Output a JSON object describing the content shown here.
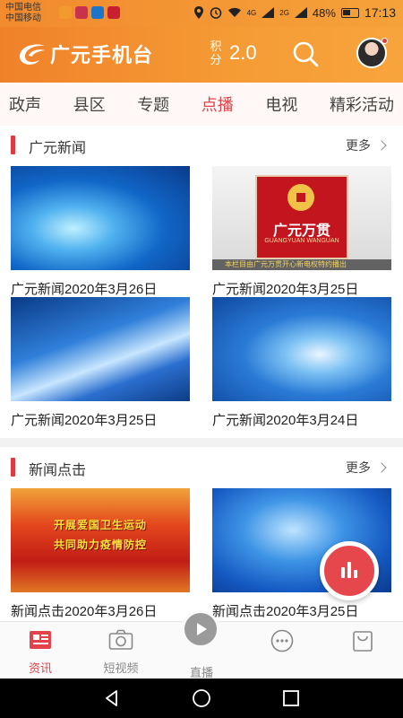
{
  "status_bar": {
    "carrier_1": "中国电信",
    "carrier_2": "中国移动",
    "network_1": "4G",
    "network_2": "2G",
    "battery": "48%",
    "time": "17:13"
  },
  "header": {
    "app_title": "广元手机台",
    "points_label_1": "积",
    "points_label_2": "分",
    "points_value": "2.0",
    "search_icon": "search-icon",
    "avatar_icon": "avatar"
  },
  "tabs": [
    {
      "label": "政声",
      "active": false
    },
    {
      "label": "县区",
      "active": false
    },
    {
      "label": "专题",
      "active": false
    },
    {
      "label": "点播",
      "active": true
    },
    {
      "label": "电视",
      "active": false
    },
    {
      "label": "精彩活动",
      "active": false
    }
  ],
  "sections": [
    {
      "title": "广元新闻",
      "more": "更多",
      "items": [
        {
          "caption": "广元新闻2020年3月26日"
        },
        {
          "caption": "广元新闻2020年3月25日",
          "brand": "广元万贯",
          "brand_sub": "GUANGYUAN WANGUAN",
          "ticker": "本栏目由广元万贯开心新电权特约播出"
        },
        {
          "caption": "广元新闻2020年3月25日"
        },
        {
          "caption": "广元新闻2020年3月24日"
        }
      ]
    },
    {
      "title": "新闻点击",
      "more": "更多",
      "items": [
        {
          "caption": "新闻点击2020年3月26日",
          "promo_line_1": "开展爱国卫生运动",
          "promo_line_2": "共同助力疫情防控"
        },
        {
          "caption": "新闻点击2020年3月25日"
        }
      ]
    }
  ],
  "bottom_nav": [
    {
      "label": "资讯",
      "icon": "news-icon",
      "active": true
    },
    {
      "label": "短视频",
      "icon": "camera-icon",
      "active": false
    },
    {
      "label": "直播",
      "icon": "play-icon",
      "active": false
    },
    {
      "label": "",
      "icon": "chat-icon",
      "active": false
    },
    {
      "label": "",
      "icon": "bag-icon",
      "active": false
    }
  ],
  "colors": {
    "accent": "#e2424a",
    "header_start": "#f0812a",
    "header_end": "#f8a43c"
  }
}
